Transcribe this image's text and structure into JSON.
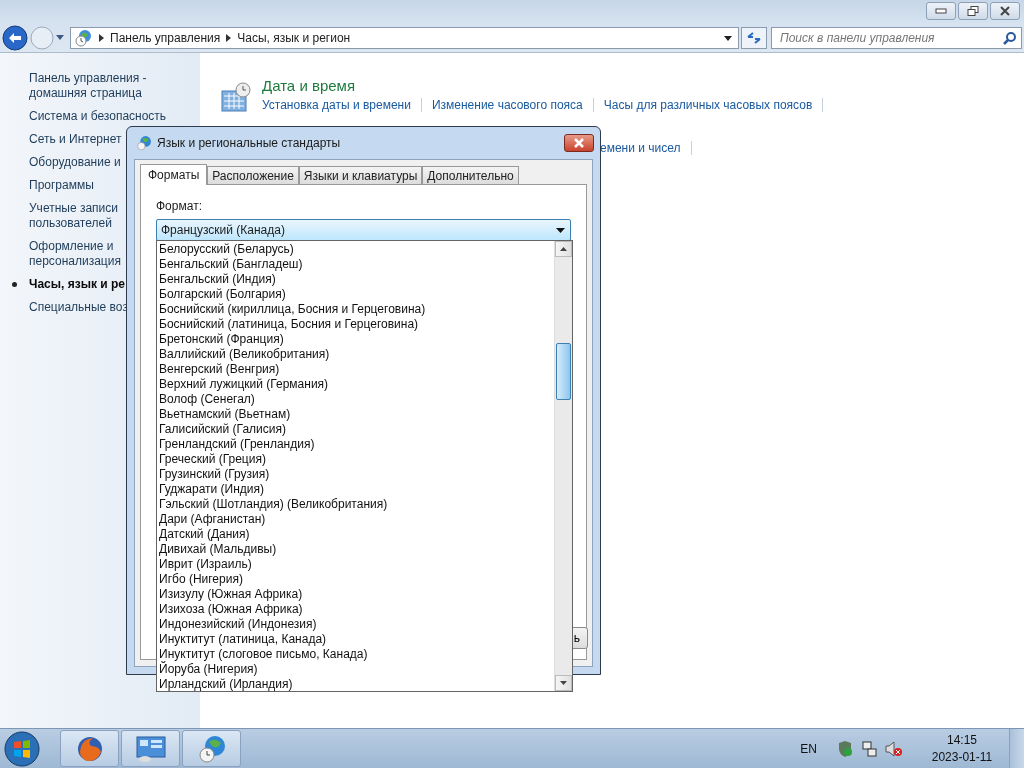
{
  "address_bar": {
    "breadcrumbs": [
      "Панель управления",
      "Часы, язык и регион"
    ]
  },
  "search": {
    "placeholder": "Поиск в панели управления"
  },
  "sidebar": {
    "items": [
      {
        "label": "Панель управления - домашняя страница",
        "selected": false
      },
      {
        "label": "Система и безопасность",
        "selected": false
      },
      {
        "label": "Сеть и Интернет",
        "selected": false
      },
      {
        "label": "Оборудование и",
        "selected": false
      },
      {
        "label": "Программы",
        "selected": false
      },
      {
        "label": "Учетные записи пользователей",
        "selected": false
      },
      {
        "label": "Оформление и персонализация",
        "selected": false
      },
      {
        "label": "Часы, язык и ре",
        "selected": true
      },
      {
        "label": "Специальные воз",
        "selected": false
      }
    ]
  },
  "categories": [
    {
      "title": "Дата и время",
      "links": [
        "Установка даты и времени",
        "Изменение часового пояса",
        "Часы для различных часовых поясов"
      ]
    },
    {
      "links": [
        "емени и чисел"
      ]
    }
  ],
  "dialog": {
    "title": "Язык и региональные стандарты",
    "tabs": [
      {
        "label": "Форматы",
        "selected": true
      },
      {
        "label": "Расположение",
        "selected": false
      },
      {
        "label": "Языки и клавиатуры",
        "selected": false
      },
      {
        "label": "Дополнительно",
        "selected": false
      }
    ],
    "format_label": "Формат:",
    "format_combo": {
      "value": "Французский (Канада)",
      "expanded": true
    },
    "options": [
      "Белорусский (Беларусь)",
      "Бенгальский (Бангладеш)",
      "Бенгальский (Индия)",
      "Болгарский (Болгария)",
      "Боснийский (кириллица, Босния и Герцеговина)",
      "Боснийский (латиница, Босния и Герцеговина)",
      "Бретонский (Франция)",
      "Валлийский (Великобритания)",
      "Венгерский (Венгрия)",
      "Верхний лужицкий (Германия)",
      "Волоф (Сенегал)",
      "Вьетнамский (Вьетнам)",
      "Галисийский (Галисия)",
      "Гренландский (Гренландия)",
      "Греческий (Греция)",
      "Грузинский (Грузия)",
      "Гуджарати (Индия)",
      "Гэльский (Шотландия) (Великобритания)",
      "Дари (Афганистан)",
      "Датский (Дания)",
      "Дивихай (Мальдивы)",
      "Иврит (Израиль)",
      "Игбо (Нигерия)",
      "Изизулу (Южная Африка)",
      "Изихоза (Южная Африка)",
      "Индонезийский (Индонезия)",
      "Инуктитут (латиница, Канада)",
      "Инуктитут (слоговое письмо, Канада)",
      "Йоруба (Нигерия)",
      "Ирландский (Ирландия)"
    ],
    "button_fragment": "ь"
  },
  "tray": {
    "language": "EN",
    "time": "14:15",
    "date": "2023-01-11"
  }
}
